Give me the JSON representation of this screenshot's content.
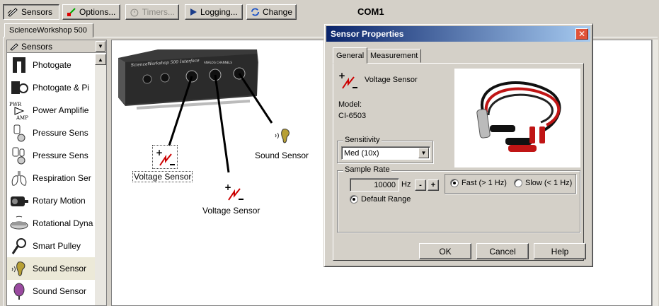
{
  "toolbar": {
    "sensors": "Sensors",
    "options": "Options...",
    "timers": "Timers...",
    "logging": "Logging...",
    "change": "Change",
    "port": "COM1"
  },
  "workspace_tab": "ScienceWorkshop 500",
  "sensor_panel": {
    "header": "Sensors",
    "items": [
      {
        "label": "Photogate",
        "icon": "photogate-icon"
      },
      {
        "label": "Photogate & Pi",
        "icon": "photogate-pulley-icon"
      },
      {
        "label": "Power Amplifie",
        "icon": "power-amplifier-icon"
      },
      {
        "label": "Pressure Sens",
        "icon": "pressure-sensor-icon"
      },
      {
        "label": "Pressure Sens",
        "icon": "pressure-sensor-icon"
      },
      {
        "label": "Respiration Ser",
        "icon": "lungs-icon"
      },
      {
        "label": "Rotary Motion",
        "icon": "rotary-motion-icon"
      },
      {
        "label": "Rotational Dyna",
        "icon": "rotational-dynamics-icon"
      },
      {
        "label": "Smart Pulley",
        "icon": "pulley-icon"
      },
      {
        "label": "Sound Sensor",
        "icon": "ear-icon"
      },
      {
        "label": "Sound Sensor",
        "icon": "microphone-icon"
      }
    ],
    "selected_index": 9
  },
  "canvas": {
    "interface_name": "ScienceWorkshop 500 Interface",
    "channel_label": "ANALOG CHANNELS",
    "sensors": [
      {
        "label": "Voltage Sensor"
      },
      {
        "label": "Voltage Sensor"
      },
      {
        "label": "Sound Sensor"
      }
    ]
  },
  "dialog": {
    "title": "Sensor Properties",
    "tabs": [
      "General",
      "Measurement"
    ],
    "sensor_name": "Voltage Sensor",
    "model_label": "Model:",
    "model_value": "CI-6503",
    "sensitivity_label": "Sensitivity",
    "sensitivity_value": "Med (10x)",
    "sample_rate_label": "Sample Rate",
    "sample_rate_value": "10000",
    "sample_rate_unit": "Hz",
    "minus": "-",
    "plus": "+",
    "fast_label": "Fast (> 1 Hz)",
    "slow_label": "Slow (< 1 Hz)",
    "default_range_label": "Default Range",
    "ok": "OK",
    "cancel": "Cancel",
    "help": "Help"
  },
  "colors": {
    "title_start": "#0a246a",
    "title_end": "#a6caf0",
    "face": "#d4d0c8"
  }
}
